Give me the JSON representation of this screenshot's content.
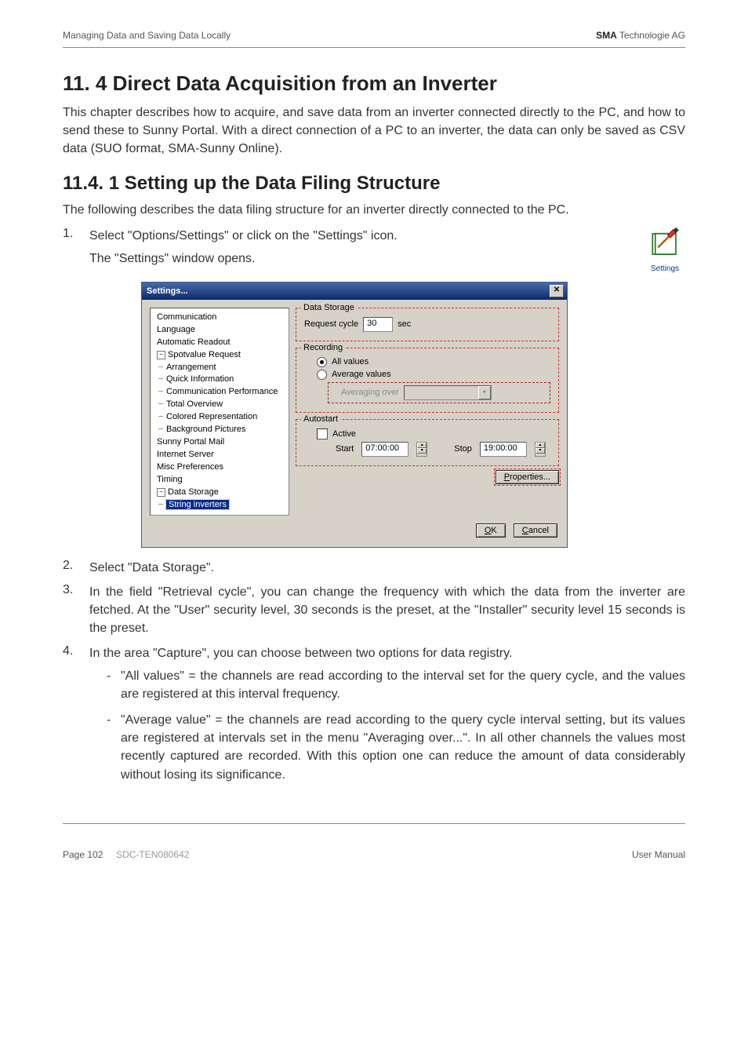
{
  "header": {
    "left": "Managing Data and Saving Data Locally",
    "right_bold": "SMA",
    "right_rest": " Technologie AG"
  },
  "section_h1": "11. 4  Direct Data Acquisition from an Inverter",
  "p1": "This chapter describes how to acquire, and save data from an inverter connected directly to the PC, and how to send these to Sunny Portal. With a direct connection of a PC to an inverter, the data can only be saved as CSV data (SUO format, SMA-Sunny Online).",
  "section_h2": "11.4. 1 Setting up the Data Filing Structure",
  "p2": "The following describes the data filing structure for an inverter directly connected to the PC.",
  "steps": {
    "s1a": "Select \"Options/Settings\" or click on the \"Settings\" icon.",
    "s1b": "The \"Settings\" window opens.",
    "s2": "Select \"Data Storage\".",
    "s3": "In the field \"Retrieval cycle\", you can change the frequency with which the data from the inverter are fetched. At the \"User\" security level, 30 seconds is the preset, at the \"Installer\" security level 15 seconds is the preset.",
    "s4": "In the area \"Capture\", you can choose between two options for data registry.",
    "s4_b1": "\"All values\" = the channels are read according to the interval set for the query cycle, and the values are registered at this interval frequency.",
    "s4_b2": "\"Average value\" = the channels are read according to the query cycle interval setting, but its values are registered at intervals set in the menu \"Averaging over...\". In all other channels the values most recently captured are recorded. With this option one can reduce the amount of data considerably without losing its significance."
  },
  "icon_label": "Settings",
  "dialog": {
    "title": "Settings...",
    "tree": {
      "n0": "Communication",
      "n1": "Language",
      "n2": "Automatic Readout",
      "n3": "Spotvalue Request",
      "n3a": "Arrangement",
      "n3b": "Quick Information",
      "n3c": "Communication Performance",
      "n3d": "Total Overview",
      "n3e": "Colored Representation",
      "n3f": "Background Pictures",
      "n4": "Sunny Portal Mail",
      "n5": "Internet Server",
      "n6": "Misc Preferences",
      "n7": "Timing",
      "n8": "Data Storage",
      "n8a": "String inverters"
    },
    "groups": {
      "data_storage": "Data Storage",
      "recording": "Recording",
      "autostart": "Autostart"
    },
    "labels": {
      "request_cycle": "Request cycle",
      "sec": "sec",
      "all_values": "All values",
      "average_values": "Average values",
      "averaging_over": "Averaging over",
      "active": "Active",
      "start": "Start",
      "stop": "Stop",
      "properties": "Properties...",
      "ok": "OK",
      "cancel": "Cancel"
    },
    "values": {
      "request_cycle": "30",
      "start": "07:00:00",
      "stop": "19:00:00"
    }
  },
  "footer": {
    "left_page": "Page 102",
    "left_code": "SDC-TEN080642",
    "right": "User Manual"
  }
}
